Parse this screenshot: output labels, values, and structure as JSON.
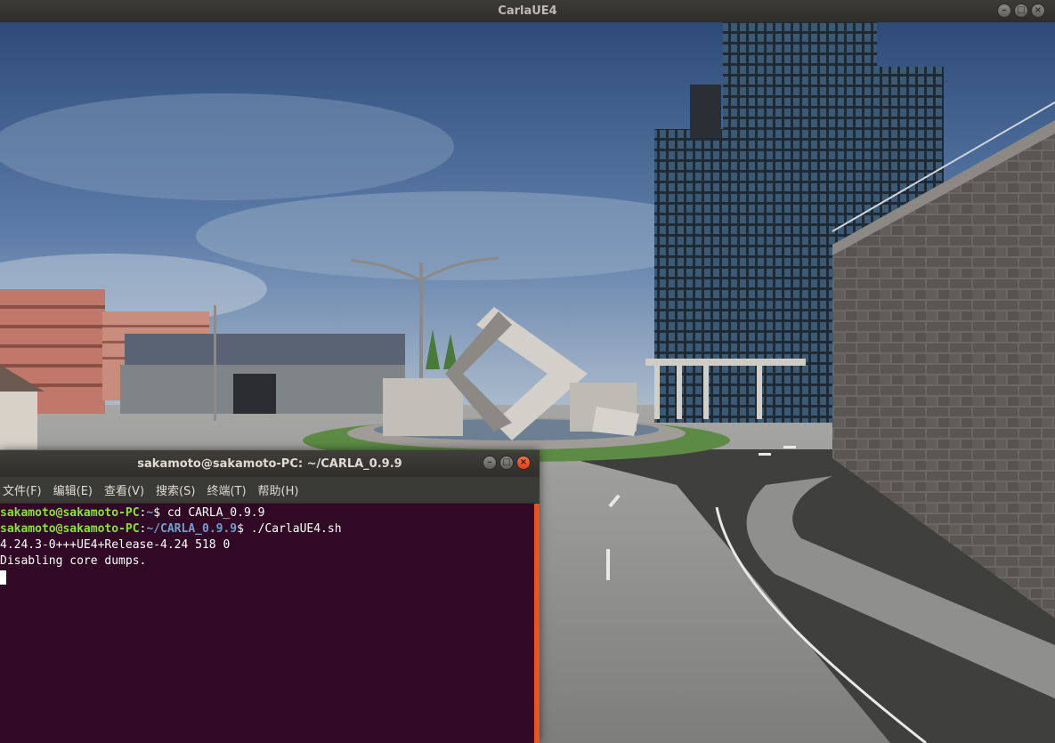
{
  "carla_window": {
    "title": "CarlaUE4",
    "buttons": {
      "minimize": "–",
      "maximize": "□",
      "close": "×"
    }
  },
  "terminal": {
    "title": "sakamoto@sakamoto-PC: ~/CARLA_0.9.9",
    "buttons": {
      "minimize": "–",
      "maximize": "□",
      "close": "×"
    },
    "menu": [
      "文件(F)",
      "编辑(E)",
      "查看(V)",
      "搜索(S)",
      "终端(T)",
      "帮助(H)"
    ],
    "lines": [
      {
        "user_host": "sakamoto@sakamoto-PC",
        "sep": ":",
        "path": "~",
        "prompt": "$ ",
        "command": "cd CARLA_0.9.9"
      },
      {
        "user_host": "sakamoto@sakamoto-PC",
        "sep": ":",
        "path": "~/CARLA_0.9.9",
        "prompt": "$ ",
        "command": "./CarlaUE4.sh"
      },
      {
        "output": "4.24.3-0+++UE4+Release-4.24 518 0"
      },
      {
        "output": "Disabling core dumps."
      }
    ],
    "colors": {
      "background": "#300a24",
      "user_host": "#8ae234",
      "path": "#729fcf",
      "scrollbar": "#e95420"
    }
  },
  "scene": {
    "description_icon": "carla-3d-scene"
  }
}
